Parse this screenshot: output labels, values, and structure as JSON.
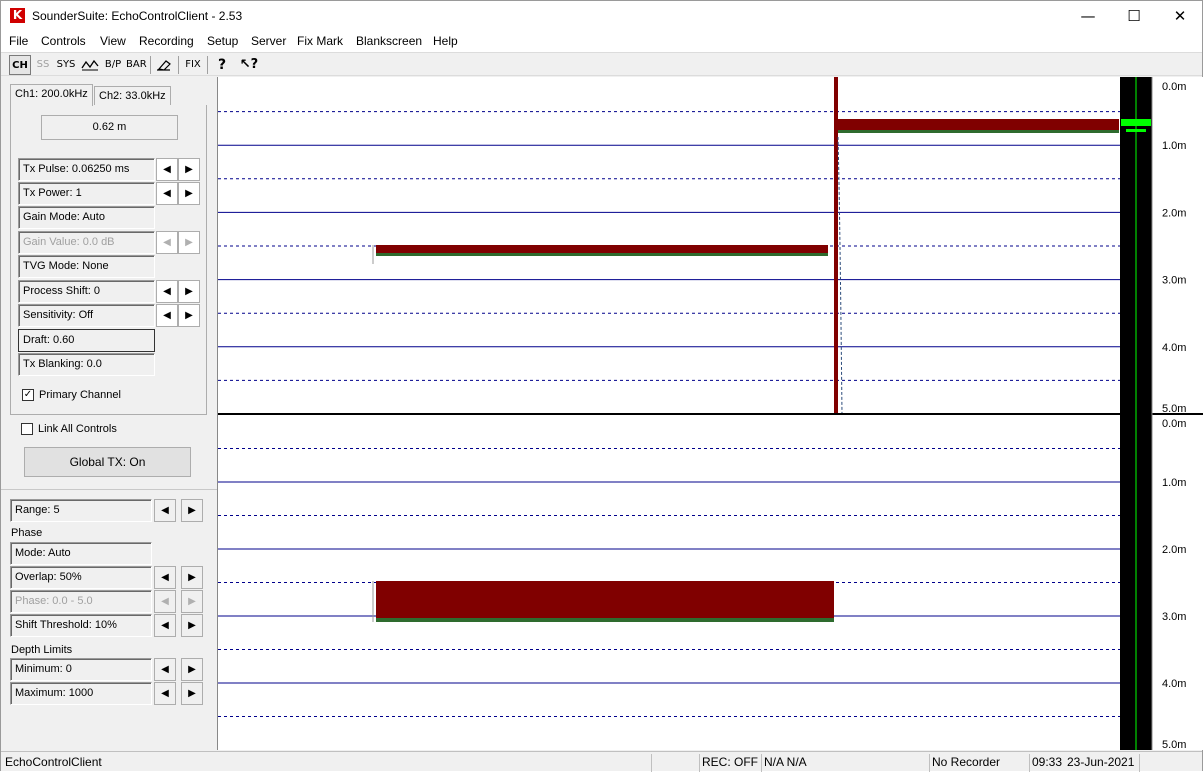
{
  "window": {
    "title": "SounderSuite: EchoControlClient - 2.53",
    "icon_letter": "K",
    "minimize": "—",
    "maximize": "☐",
    "close": "✕"
  },
  "menu": [
    "File",
    "Controls",
    "View",
    "Recording",
    "Setup",
    "Server",
    "Fix Mark",
    "Blankscreen",
    "Help"
  ],
  "toolbar": {
    "ch": "CH",
    "ss": "SS",
    "sys": "SYS",
    "bp": "B/P",
    "bar": "BAR",
    "fix": "FIX"
  },
  "tabs": [
    "Ch1: 200.0kHz",
    "Ch2: 33.0kHz"
  ],
  "channel": {
    "depth_readout": "0.62 m",
    "tx_pulse": "Tx Pulse: 0.06250 ms",
    "tx_power": "Tx Power: 1",
    "gain_mode": "Gain Mode: Auto",
    "gain_value": "Gain Value:  0.0 dB",
    "tvg_mode": "TVG Mode: None",
    "process_shift": "Process Shift: 0",
    "sensitivity": "Sensitivity: Off",
    "draft": "Draft: 0.60",
    "tx_blanking": "Tx Blanking: 0.0",
    "primary_channel": "Primary Channel"
  },
  "link_all": "Link All Controls",
  "global_tx": "Global TX: On",
  "range": "Range: 5",
  "phase": {
    "heading": "Phase",
    "mode": "Mode: Auto",
    "overlap": "Overlap: 50%",
    "phase": "Phase: 0.0 - 5.0",
    "shift_threshold": "Shift Threshold: 10%"
  },
  "depth_limits": {
    "heading": "Depth Limits",
    "minimum": "Minimum: 0",
    "maximum": "Maximum: 1000"
  },
  "echogram": {
    "top_labels": [
      "0.0m",
      "1.0m",
      "2.0m",
      "3.0m",
      "4.0m",
      "5.0m"
    ],
    "bottom_labels": [
      "0.0m",
      "1.0m",
      "2.0m",
      "3.0m",
      "4.0m",
      "5.0m"
    ],
    "echo_color": "#800000",
    "grid_color": "#00008b",
    "bar_marker_color": "#00ff00"
  },
  "status": {
    "app": "EchoControlClient",
    "rec": "REC: OFF",
    "na": "N/A N/A",
    "recorder": "No Recorder",
    "time": "09:33",
    "date": "23-Jun-2021"
  }
}
